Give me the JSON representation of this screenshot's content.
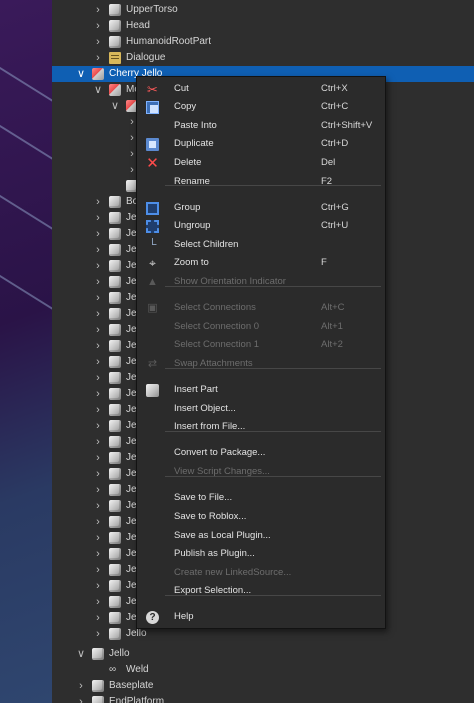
{
  "explorer": {
    "top_items": [
      {
        "label": "UpperTorso"
      },
      {
        "label": "Head"
      },
      {
        "label": "HumanoidRootPart"
      },
      {
        "label": "Dialogue"
      }
    ],
    "selected": {
      "label": "Cherry Jello"
    },
    "model_child": {
      "label": "Mo"
    },
    "bo_item": {
      "label": "Bo"
    },
    "jello_prefix": "Jel",
    "jello_last": "Jello",
    "bottom_items": [
      {
        "label": "Jello"
      },
      {
        "label": "Weld"
      },
      {
        "label": "Baseplate"
      },
      {
        "label": "EndPlatform"
      }
    ]
  },
  "context_menu": {
    "items": [
      {
        "label": "Cut",
        "shortcut": "Ctrl+X",
        "icon": "scissors-icon",
        "enabled": true
      },
      {
        "label": "Copy",
        "shortcut": "Ctrl+C",
        "icon": "copy-icon",
        "enabled": true
      },
      {
        "label": "Paste Into",
        "shortcut": "Ctrl+Shift+V",
        "icon": "",
        "enabled": true
      },
      {
        "label": "Duplicate",
        "shortcut": "Ctrl+D",
        "icon": "duplicate-icon",
        "enabled": true
      },
      {
        "label": "Delete",
        "shortcut": "Del",
        "icon": "delete-icon",
        "enabled": true
      },
      {
        "label": "Rename",
        "shortcut": "F2",
        "icon": "",
        "enabled": true
      },
      {
        "label": "Group",
        "shortcut": "Ctrl+G",
        "icon": "group-icon",
        "enabled": true
      },
      {
        "label": "Ungroup",
        "shortcut": "Ctrl+U",
        "icon": "ungroup-icon",
        "enabled": true
      },
      {
        "label": "Select Children",
        "shortcut": "",
        "icon": "select-children-icon",
        "enabled": true
      },
      {
        "label": "Zoom to",
        "shortcut": "F",
        "icon": "zoom-to-icon",
        "enabled": true
      },
      {
        "label": "Show Orientation Indicator",
        "shortcut": "",
        "icon": "orientation-icon",
        "enabled": false
      },
      {
        "label": "Select Connections",
        "shortcut": "Alt+C",
        "icon": "connections-icon",
        "enabled": false
      },
      {
        "label": "Select Connection 0",
        "shortcut": "Alt+1",
        "icon": "",
        "enabled": false
      },
      {
        "label": "Select Connection 1",
        "shortcut": "Alt+2",
        "icon": "",
        "enabled": false
      },
      {
        "label": "Swap Attachments",
        "shortcut": "",
        "icon": "swap-icon",
        "enabled": false
      },
      {
        "label": "Insert Part",
        "shortcut": "",
        "icon": "insert-part-icon",
        "enabled": true
      },
      {
        "label": "Insert Object...",
        "shortcut": "",
        "icon": "",
        "enabled": true
      },
      {
        "label": "Insert from File...",
        "shortcut": "",
        "icon": "",
        "enabled": true
      },
      {
        "label": "Convert to Package...",
        "shortcut": "",
        "icon": "",
        "enabled": true
      },
      {
        "label": "View Script Changes...",
        "shortcut": "",
        "icon": "",
        "enabled": false
      },
      {
        "label": "Save to File...",
        "shortcut": "",
        "icon": "",
        "enabled": true
      },
      {
        "label": "Save to Roblox...",
        "shortcut": "",
        "icon": "",
        "enabled": true
      },
      {
        "label": "Save as Local Plugin...",
        "shortcut": "",
        "icon": "",
        "enabled": true
      },
      {
        "label": "Publish as Plugin...",
        "shortcut": "",
        "icon": "",
        "enabled": true
      },
      {
        "label": "Create new LinkedSource...",
        "shortcut": "",
        "icon": "",
        "enabled": false
      },
      {
        "label": "Export Selection...",
        "shortcut": "",
        "icon": "",
        "enabled": true
      },
      {
        "label": "Help",
        "shortcut": "",
        "icon": "help-icon",
        "enabled": true
      }
    ]
  },
  "colors": {
    "selection": "#0f5fb3",
    "panel_bg": "#2e2e2e",
    "menu_bg": "#2b2b2b"
  }
}
